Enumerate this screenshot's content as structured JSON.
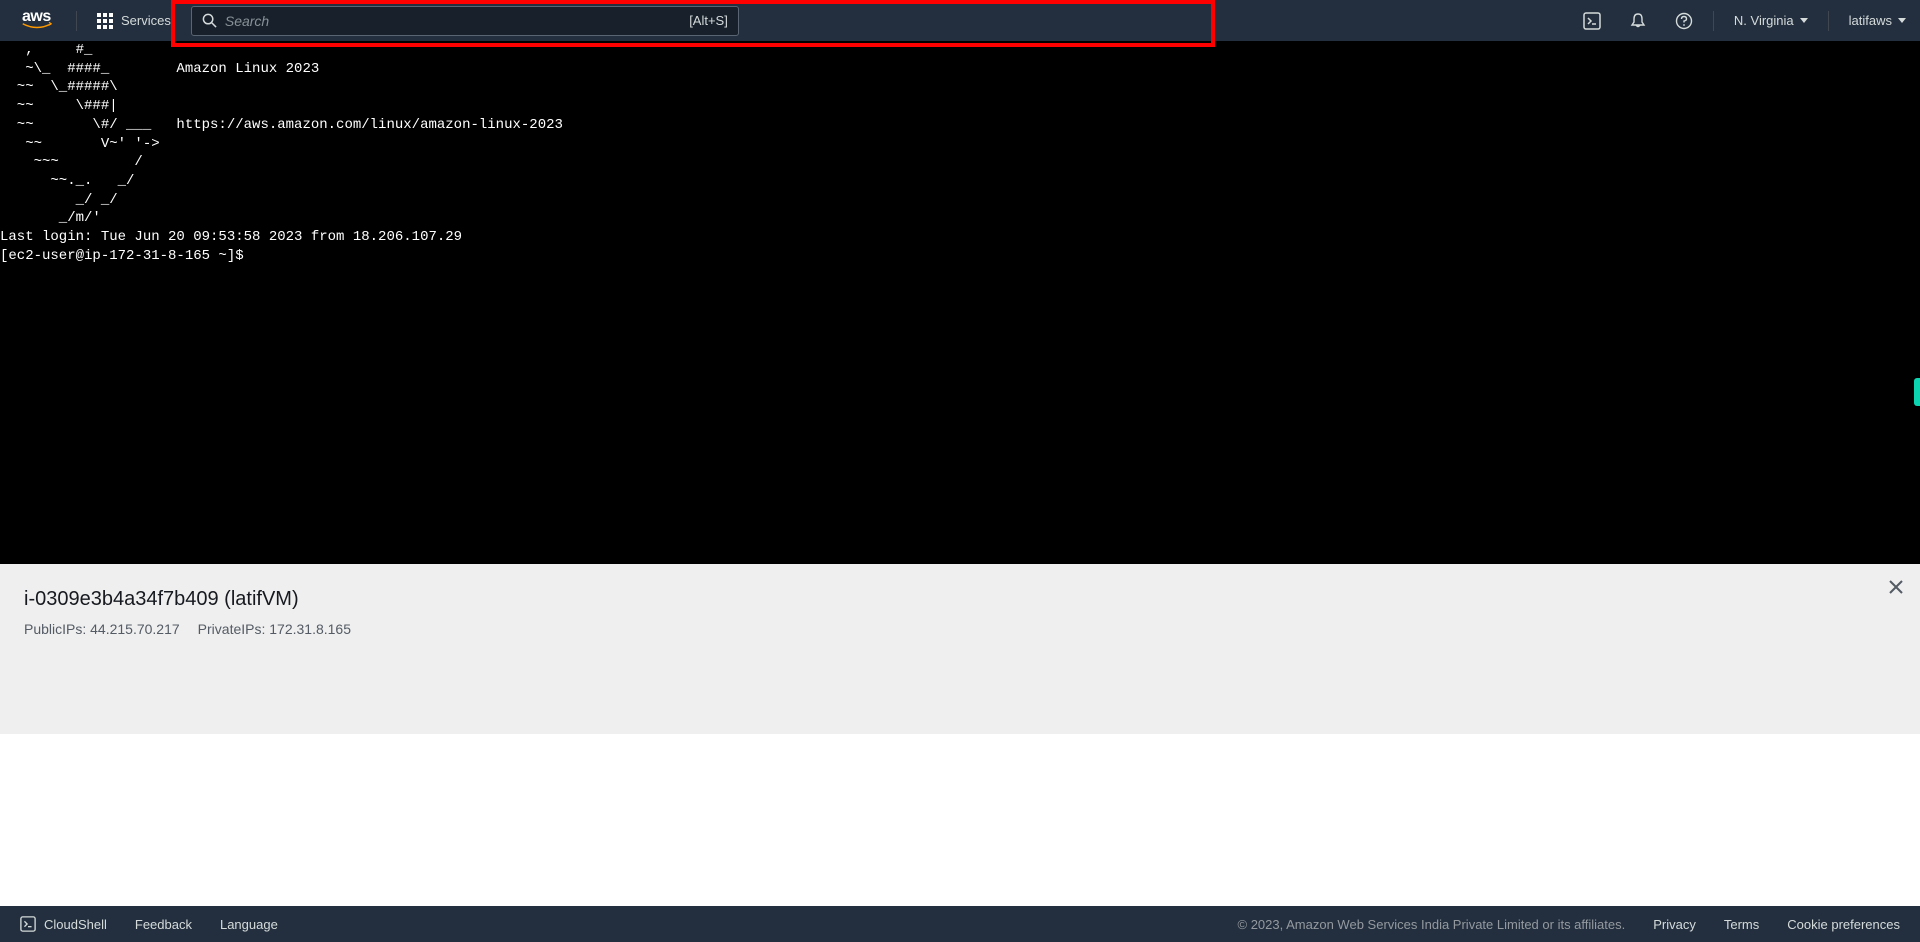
{
  "nav": {
    "logo_text": "aws",
    "services_label": "Services",
    "search_placeholder": "Search",
    "search_shortcut": "[Alt+S]",
    "region_label": "N. Virginia",
    "account_label": "latifaws"
  },
  "terminal": {
    "content": "   ,     #_\n   ~\\_  ####_        Amazon Linux 2023\n  ~~  \\_#####\\\n  ~~     \\###|\n  ~~       \\#/ ___   https://aws.amazon.com/linux/amazon-linux-2023\n   ~~       V~' '->\n    ~~~         /\n      ~~._.   _/\n         _/ _/\n       _/m/'\nLast login: Tue Jun 20 09:53:58 2023 from 18.206.107.29\n[ec2-user@ip-172-31-8-165 ~]$ "
  },
  "info": {
    "title": "i-0309e3b4a34f7b409 (latifVM)",
    "public_ip_label": "PublicIPs: 44.215.70.217",
    "private_ip_label": "PrivateIPs: 172.31.8.165"
  },
  "footer": {
    "cloudshell_label": "CloudShell",
    "feedback_label": "Feedback",
    "language_label": "Language",
    "copyright": "© 2023, Amazon Web Services India Private Limited or its affiliates.",
    "privacy": "Privacy",
    "terms": "Terms",
    "cookie": "Cookie preferences"
  }
}
